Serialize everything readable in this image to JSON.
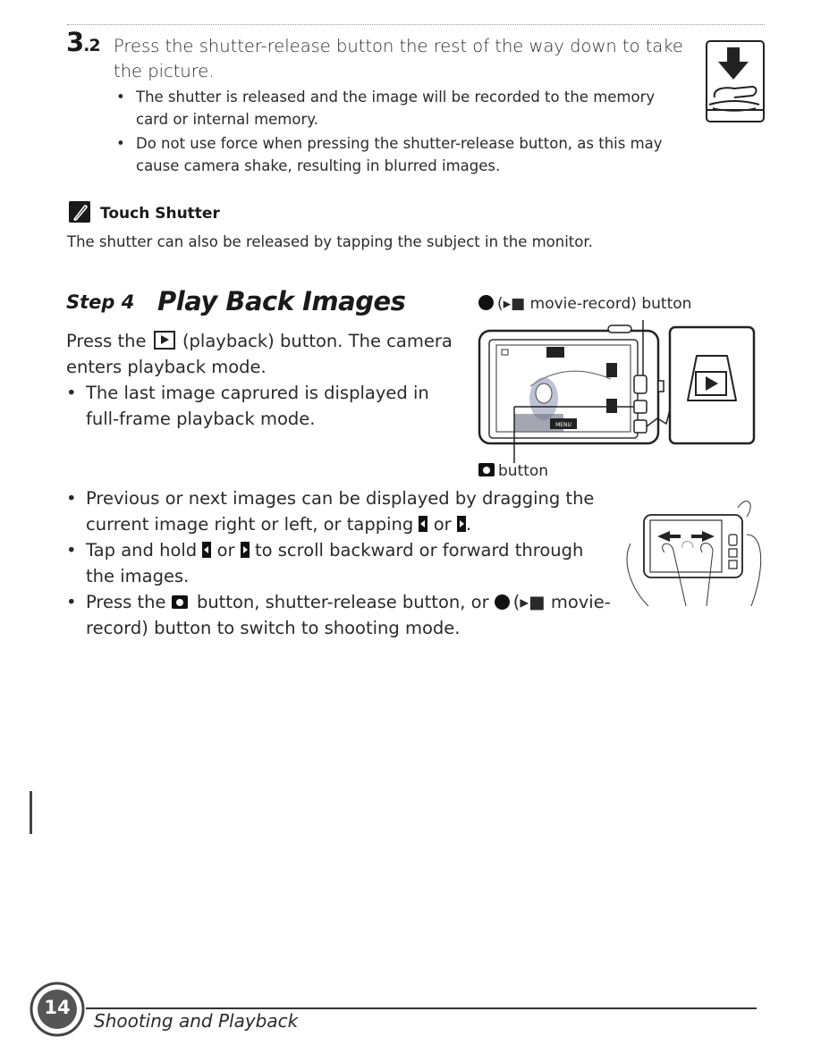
{
  "section_3_2": {
    "number": "3",
    "sub_number": ".2",
    "instruction": "Press the shutter-release button the rest of the way down to take the picture.",
    "bullets": [
      "The shutter is released and the image will be recorded to the memory card or internal memory.",
      "Do not use force when pressing the shutter-release button, as this may cause camera shake, resulting in blurred images."
    ],
    "illustration": "shutter-press-icon"
  },
  "note": {
    "icon": "pencil-note-icon",
    "title": "Touch Shutter",
    "body": "The shutter can also be released by tapping the subject in the monitor."
  },
  "step4": {
    "label": "Step 4",
    "title": "Play Back Images",
    "lead_before": "Press the",
    "lead_after": "(playback) button. The camera enters playback mode.",
    "bullets": [
      "The last image caprured is displayed in full-frame playback mode."
    ],
    "callouts": {
      "movie_record_prefix": "(",
      "movie_record": "movie-record) button",
      "camera_button": "button"
    },
    "screen_labels": {
      "menu": "MENU"
    }
  },
  "more_bullets": {
    "b1_part1": "Previous or next images can be displayed by dragging the current image right or left, or tapping",
    "b1_or": "or",
    "b1_end": ".",
    "b2_part1": "Tap and hold",
    "b2_or": "or",
    "b2_part2": "to scroll backward or forward through the images.",
    "b3_part1": "Press the",
    "b3_part2": "button, shutter-release button, or",
    "b3_part3": "(",
    "b3_part4": "movie-record) button to switch to shooting mode."
  },
  "footer": {
    "page_number": "14",
    "section_title": "Shooting and Playback"
  }
}
